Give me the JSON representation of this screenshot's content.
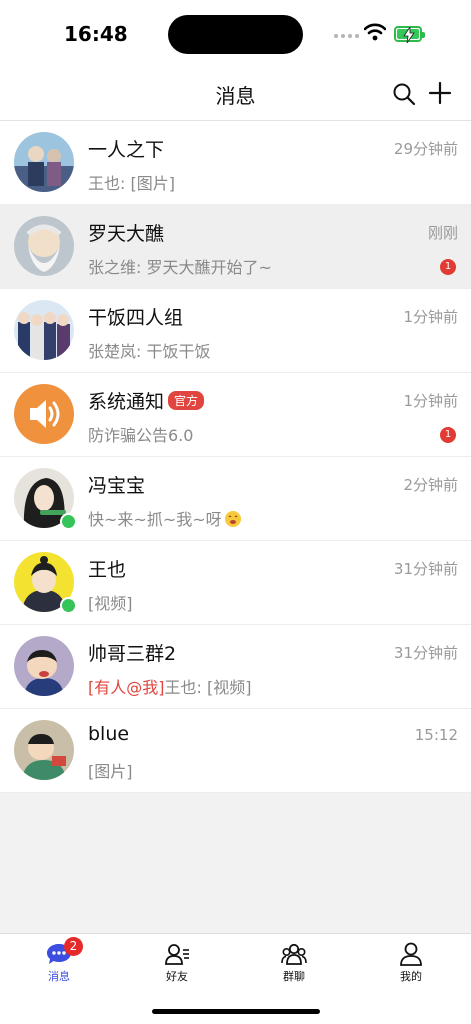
{
  "status_bar": {
    "time": "16:48"
  },
  "header": {
    "title": "消息",
    "search_icon": "search-icon",
    "add_icon": "plus-icon"
  },
  "conversations": [
    {
      "name": "一人之下",
      "time": "29分钟前",
      "preview": "王也: [图片]"
    },
    {
      "name": "罗天大醮",
      "time": "刚刚",
      "preview": "张之维: 罗天大醮开始了~",
      "unread": "1"
    },
    {
      "name": "干饭四人组",
      "time": "1分钟前",
      "preview": "张楚岚: 干饭干饭"
    },
    {
      "name": "系统通知",
      "tag": "官方",
      "time": "1分钟前",
      "preview": "防诈骗公告6.0",
      "unread": "1"
    },
    {
      "name": "冯宝宝",
      "time": "2分钟前",
      "preview": "快~来~抓~我~呀"
    },
    {
      "name": "王也",
      "time": "31分钟前",
      "preview": "[视频]"
    },
    {
      "name": "帅哥三群2",
      "time": "31分钟前",
      "mention": "[有人@我]",
      "preview": "王也: [视频]"
    },
    {
      "name": "blue",
      "time": "15:12",
      "preview": "[图片]"
    }
  ],
  "tabs": [
    {
      "label": "消息",
      "icon": "chat-icon",
      "badge": "2"
    },
    {
      "label": "好友",
      "icon": "friends-icon"
    },
    {
      "label": "群聊",
      "icon": "group-icon"
    },
    {
      "label": "我的",
      "icon": "profile-icon"
    }
  ],
  "colors": {
    "accent": "#3b4ee0",
    "badge": "#e33a33",
    "online": "#36c35a",
    "system_avatar": "#f0913d"
  }
}
